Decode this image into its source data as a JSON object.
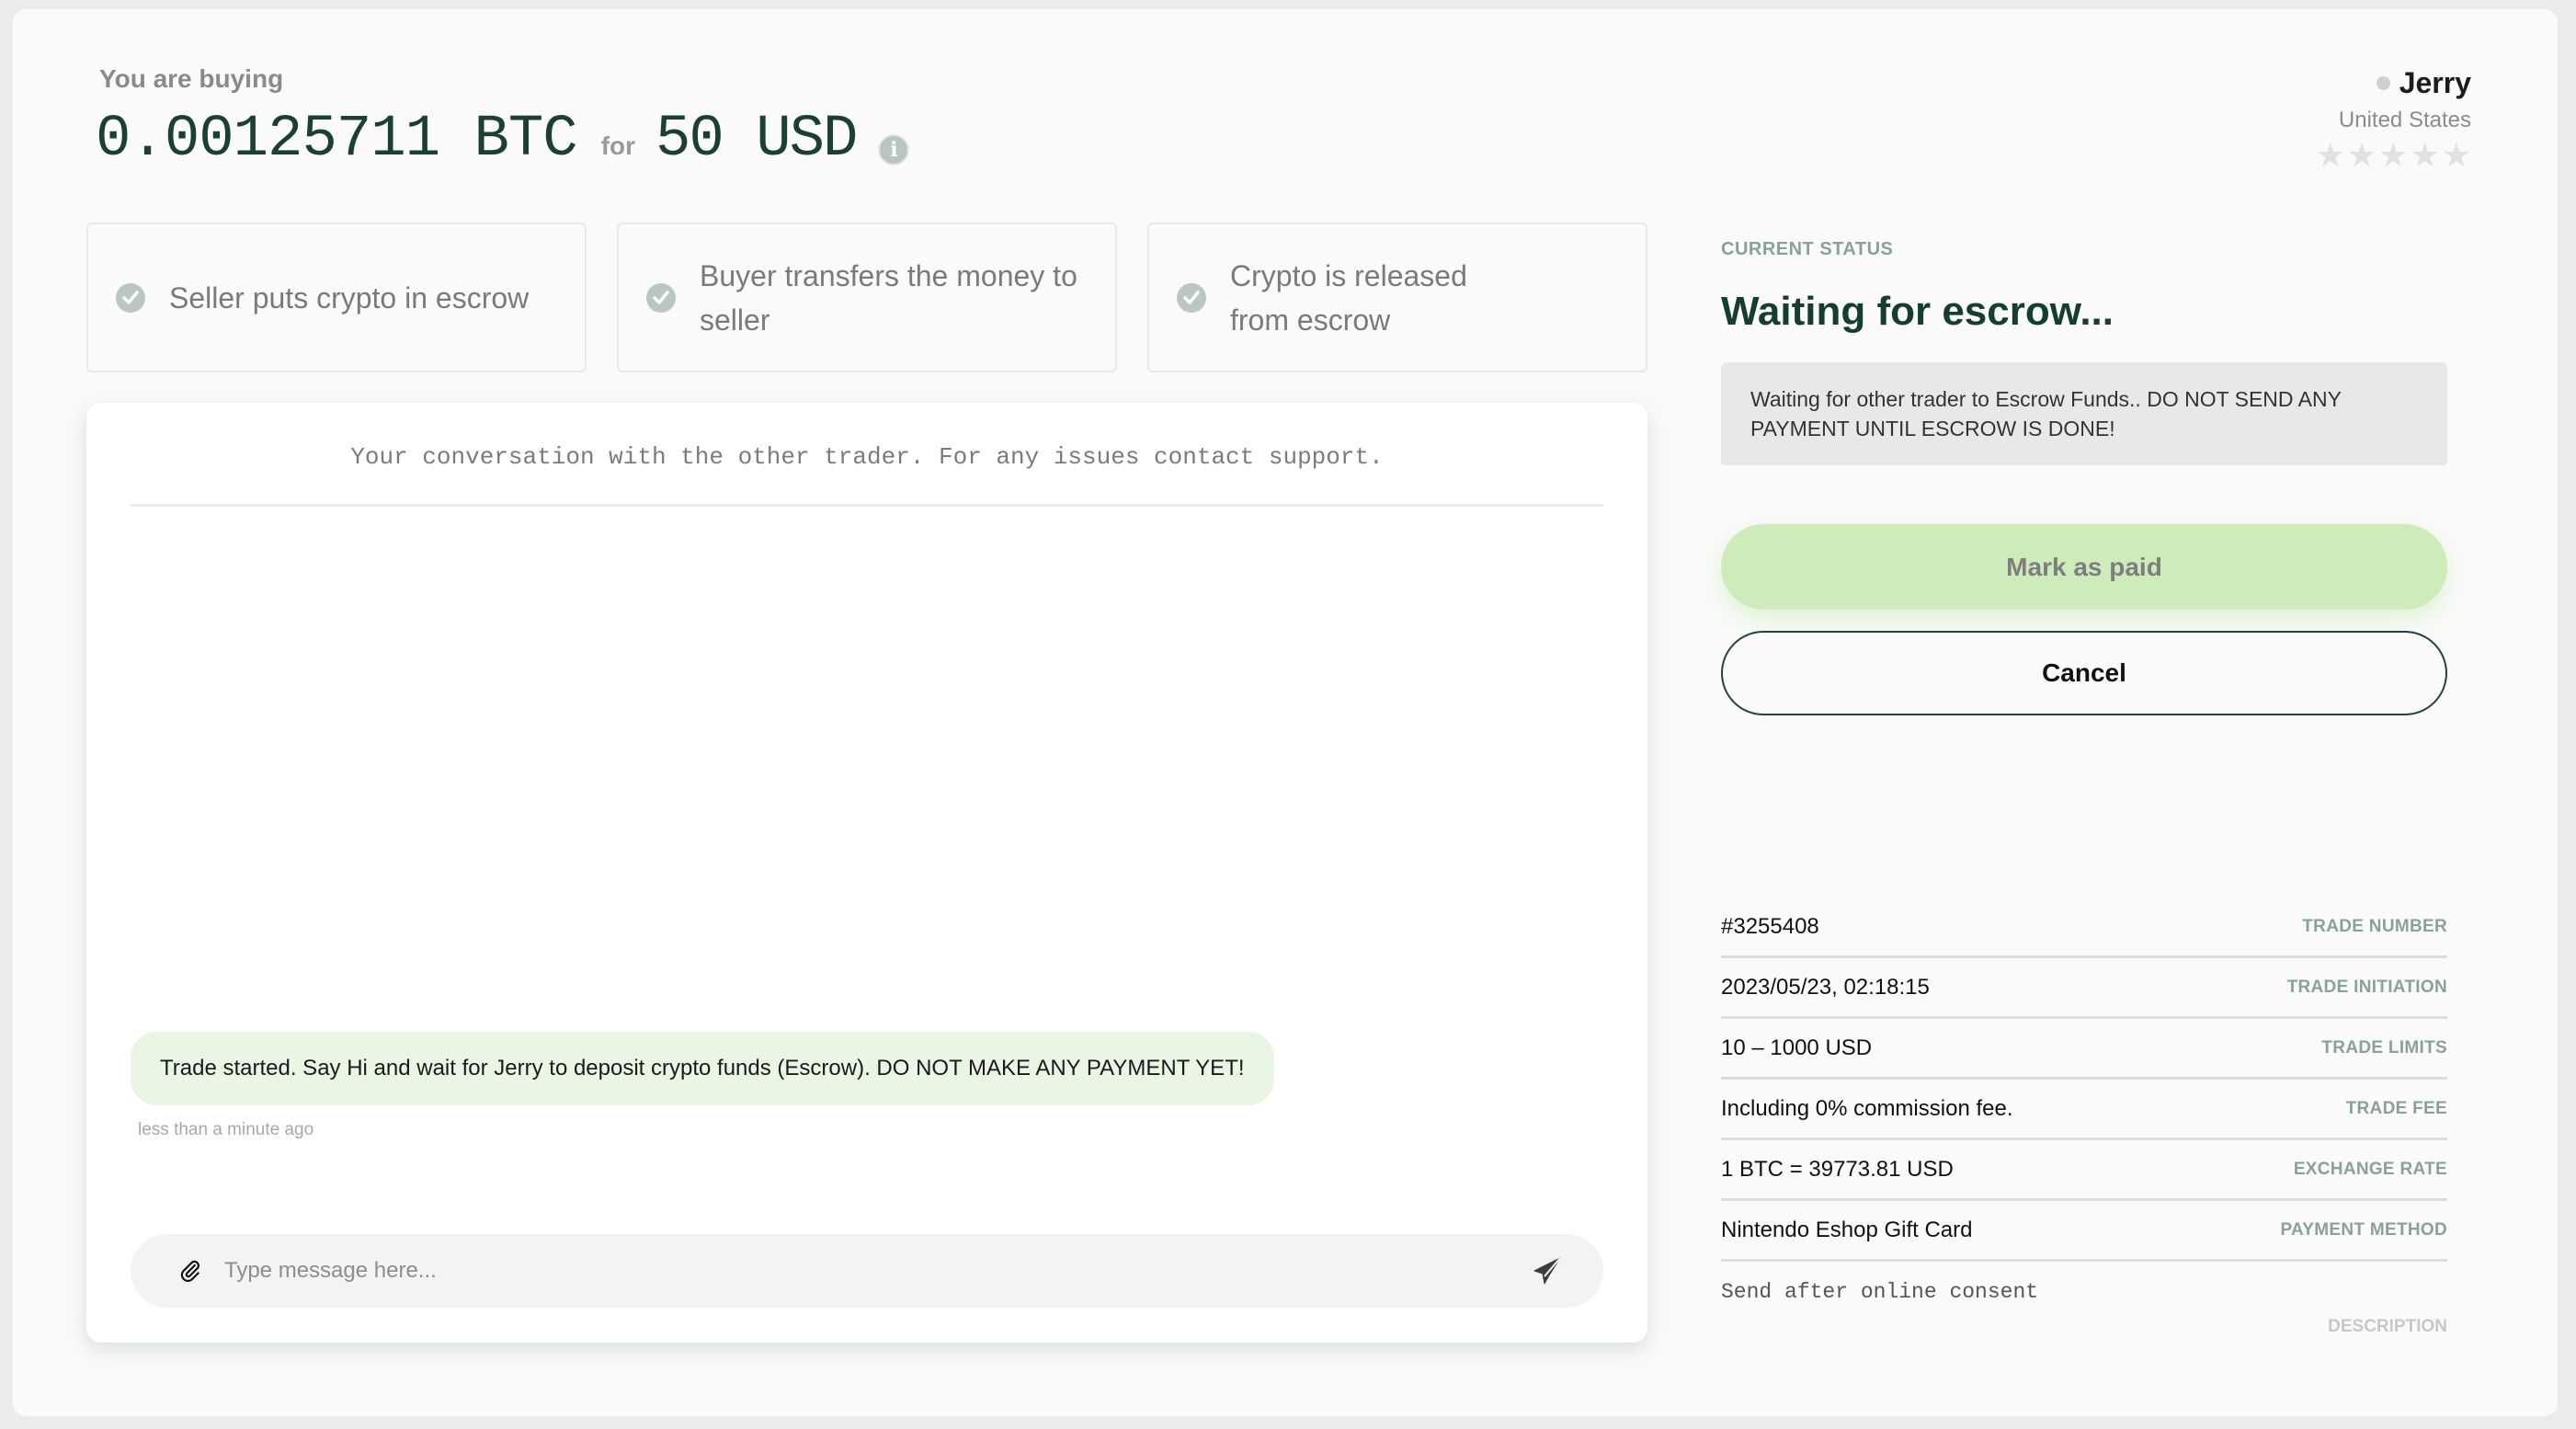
{
  "header": {
    "buying_label": "You are buying",
    "crypto_amount": "0.00125711 BTC",
    "for_label": "for",
    "fiat_amount": "50 USD",
    "info_icon": "info-icon"
  },
  "trader": {
    "name": "Jerry",
    "country": "United States",
    "online_status": "offline",
    "rating_stars": 0,
    "rating_max": 5
  },
  "steps": [
    {
      "label": "Seller puts crypto in escrow",
      "icon": "check-circle-icon"
    },
    {
      "label": "Buyer transfers the money to seller",
      "icon": "check-circle-icon"
    },
    {
      "label": "Crypto is released from escrow",
      "icon": "check-circle-icon"
    }
  ],
  "chat": {
    "intro": "Your conversation with the other trader. For any issues contact support.",
    "messages": [
      {
        "text": "Trade started. Say Hi and wait for Jerry to deposit crypto funds (Escrow). DO NOT MAKE ANY PAYMENT YET!",
        "time": "less than a minute ago"
      }
    ],
    "input_placeholder": "Type message here...",
    "input_value": "",
    "attach_icon": "paperclip-icon",
    "send_icon": "paper-plane-icon"
  },
  "status": {
    "label": "CURRENT STATUS",
    "title": "Waiting for escrow...",
    "notice": "Waiting for other trader to Escrow Funds.. DO NOT SEND ANY PAYMENT UNTIL ESCROW IS DONE!"
  },
  "actions": {
    "mark_paid": "Mark as paid",
    "cancel": "Cancel"
  },
  "details": [
    {
      "value": "#3255408",
      "key": "TRADE NUMBER"
    },
    {
      "value": "2023/05/23, 02:18:15",
      "key": "TRADE INITIATION"
    },
    {
      "value": "10 – 1000 USD",
      "key": "TRADE LIMITS"
    },
    {
      "value": "Including 0% commission fee.",
      "key": "TRADE FEE"
    },
    {
      "value": "1 BTC = 39773.81 USD",
      "key": "EXCHANGE RATE"
    },
    {
      "value": "Nintendo Eshop Gift Card",
      "key": "PAYMENT METHOD"
    }
  ],
  "description": {
    "value": "Send after online consent",
    "key": "DESCRIPTION"
  },
  "colors": {
    "brand_dark_green": "#1b3f35",
    "accent_light_green": "#cdecb9",
    "bubble_green": "#eaf6e4",
    "muted_label": "#8aa198"
  }
}
